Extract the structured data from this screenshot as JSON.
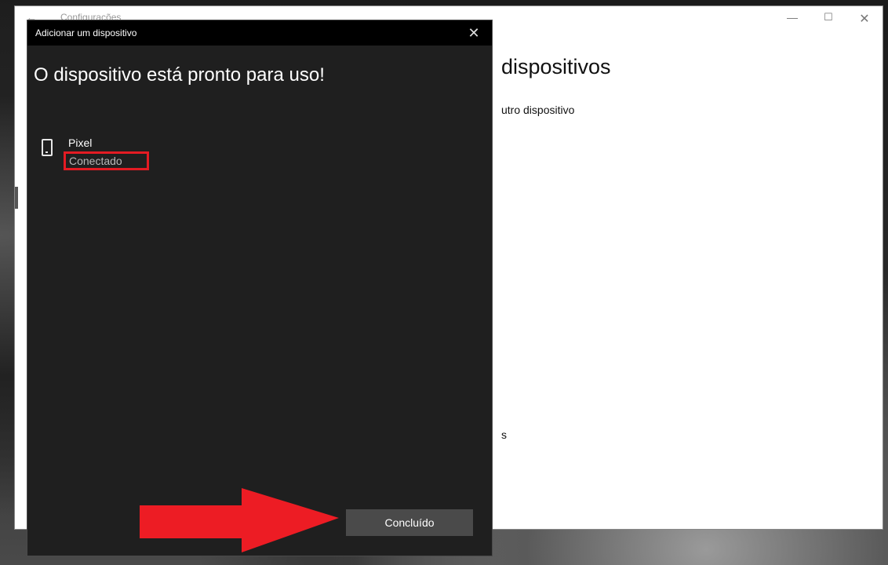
{
  "settings_window": {
    "title": "Configurações",
    "heading": "dispositivos",
    "link_fragment": "utro dispositivo",
    "section_fragment": "s",
    "controls": {
      "minimize": "—",
      "maximize": "☐",
      "close": "✕"
    }
  },
  "dialog": {
    "title": "Adicionar um dispositivo",
    "close_glyph": "✕",
    "heading": "O dispositivo está pronto para uso!",
    "device": {
      "name": "Pixel",
      "status": "Conectado",
      "icon": "phone-icon"
    },
    "done_label": "Concluído"
  },
  "annotations": {
    "highlight_color": "#e31b23",
    "arrow_color": "#ed1c24"
  }
}
